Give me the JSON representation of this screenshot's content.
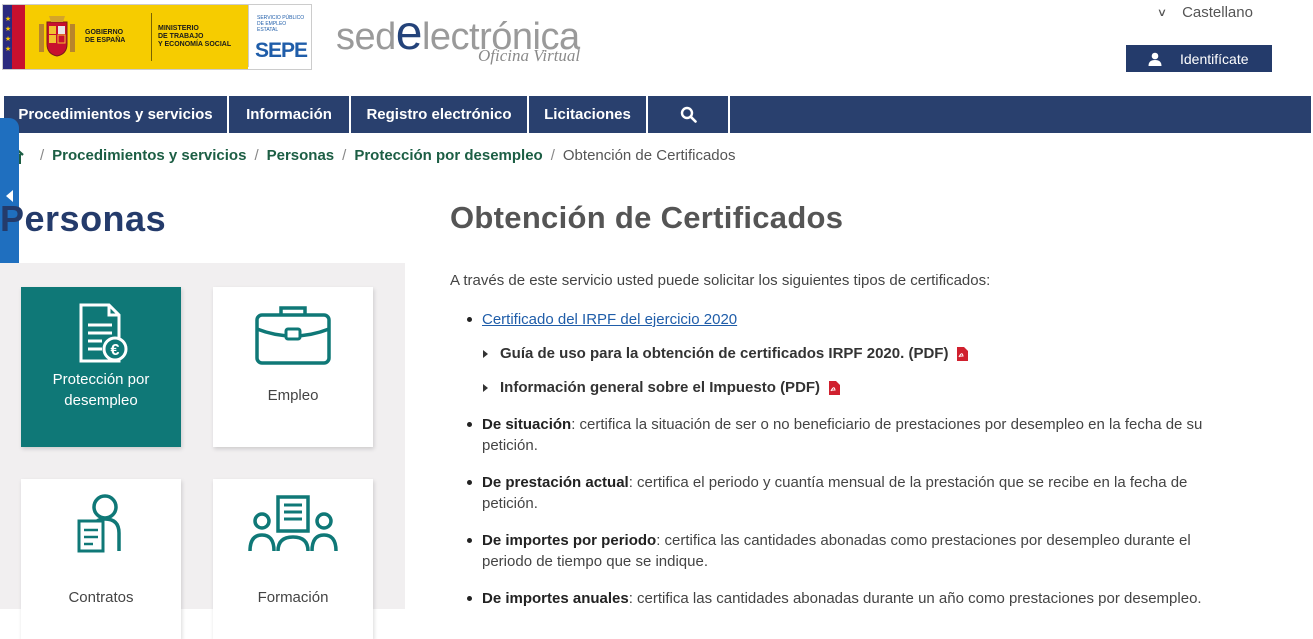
{
  "header": {
    "gov_line1": "GOBIERNO",
    "gov_line2": "DE ESPAÑA",
    "min_line1": "MINISTERIO",
    "min_line2": "DE TRABAJO",
    "min_line3": "Y ECONOMÍA SOCIAL",
    "sepe_small_1": "SERVICIO PÚBLICO",
    "sepe_small_2": "DE EMPLEO ESTATAL",
    "sepe_big": "SEPE",
    "sede_prefix": "sed",
    "sede_e": "e",
    "sede_suffix": "lectrónica",
    "oficina": "Oficina Virtual",
    "language": "Castellano",
    "login_label": "Identifícate"
  },
  "nav": {
    "items": [
      "Procedimientos y servicios",
      "Información",
      "Registro electrónico",
      "Licitaciones"
    ]
  },
  "breadcrumb": {
    "items": [
      "Procedimientos y servicios",
      "Personas",
      "Protección por desempleo"
    ],
    "current": "Obtención de Certificados",
    "separator": "/"
  },
  "sidebar": {
    "title": "Personas",
    "tiles": [
      {
        "line1": "Protección por",
        "line2": "desempleo",
        "icon": "certificate-euro-icon"
      },
      {
        "line1": "Empleo",
        "icon": "briefcase-icon"
      },
      {
        "line1": "Contratos",
        "icon": "person-document-icon"
      },
      {
        "line1": "Formación",
        "icon": "training-group-icon"
      }
    ]
  },
  "main": {
    "title": "Obtención de Certificados",
    "intro": "A través de este servicio usted puede solicitar los siguientes tipos de certificados:",
    "irpf_link": "Certificado del IRPF del ejercicio 2020",
    "sub1": "Guía de uso para la obtención de certificados IRPF 2020. (PDF)",
    "sub2": "Información general sobre el Impuesto (PDF)",
    "items": [
      {
        "term": "De situación",
        "desc_a": ": certifica la situación de ser o no beneficiario de prestaciones por desempleo en la fecha de su",
        "desc_b": "petición."
      },
      {
        "term": "De prestación actual",
        "desc_a": ": certifica el periodo y cuantía mensual de la prestación que se recibe en la fecha de",
        "desc_b": "petición."
      },
      {
        "term": "De importes por periodo",
        "desc_a": ": certifica las cantidades abonadas como prestaciones por desempleo durante el",
        "desc_b": "periodo de tiempo que se indique."
      },
      {
        "term": "De importes anuales",
        "desc_a": ": certifica las cantidades abonadas durante un año como prestaciones por desempleo.",
        "desc_b": ""
      }
    ]
  },
  "colors": {
    "nav_bg": "#29406e",
    "accent_teal": "#0f7877",
    "link_green": "#1c5e44",
    "link_blue": "#1f5da9",
    "pdf_red": "#d0202e"
  }
}
